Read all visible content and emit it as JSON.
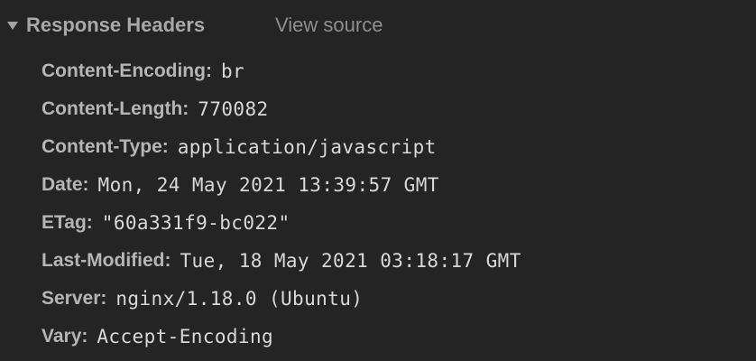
{
  "section": {
    "title": "Response Headers",
    "view_source_label": "View source",
    "expanded_icon": "triangle-down-icon"
  },
  "headers": [
    {
      "name": "Content-Encoding",
      "value": "br"
    },
    {
      "name": "Content-Length",
      "value": "770082"
    },
    {
      "name": "Content-Type",
      "value": "application/javascript"
    },
    {
      "name": "Date",
      "value": "Mon, 24 May 2021 13:39:57 GMT"
    },
    {
      "name": "ETag",
      "value": "\"60a331f9-bc022\""
    },
    {
      "name": "Last-Modified",
      "value": "Tue, 18 May 2021 03:18:17 GMT"
    },
    {
      "name": "Server",
      "value": "nginx/1.18.0 (Ubuntu)"
    },
    {
      "name": "Vary",
      "value": "Accept-Encoding"
    }
  ],
  "colon": ":"
}
